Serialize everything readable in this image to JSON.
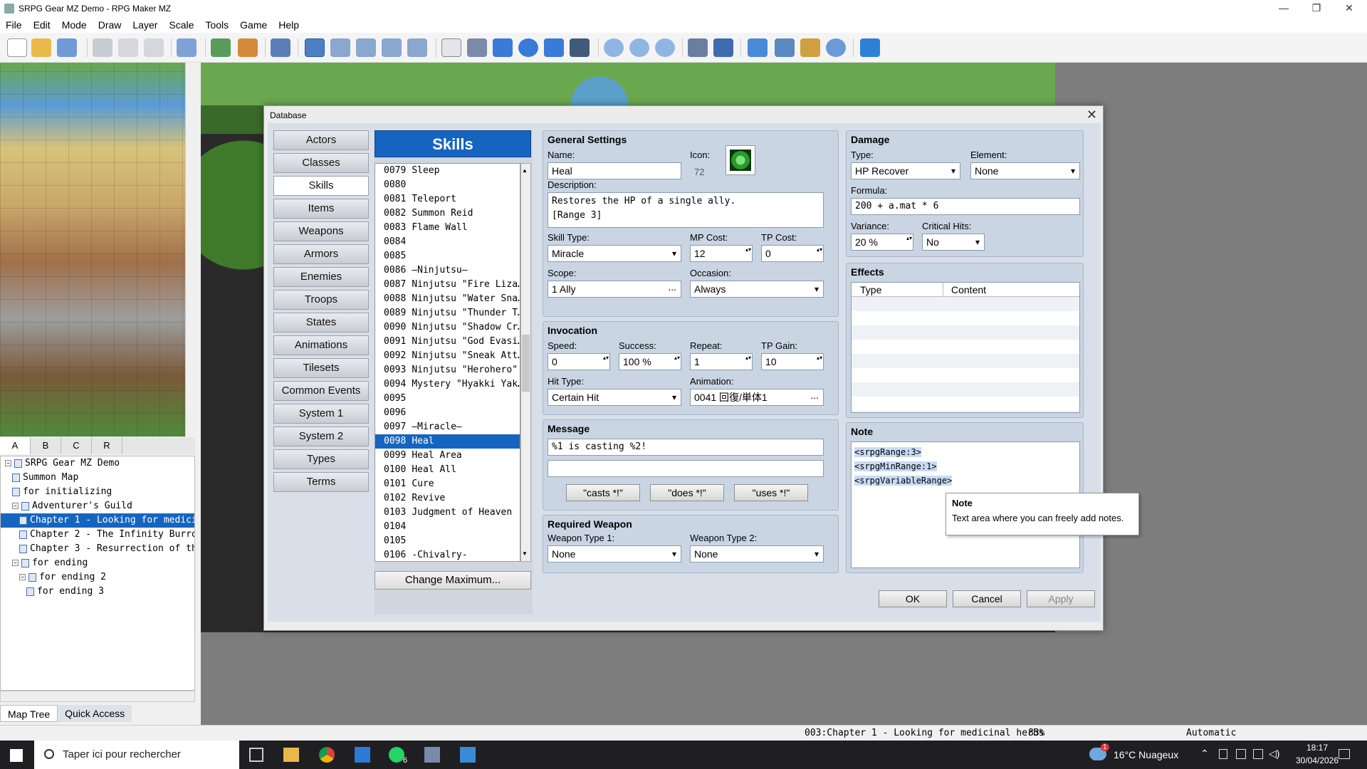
{
  "window": {
    "title": "SRPG Gear MZ Demo - RPG Maker MZ",
    "minimize": "—",
    "restore": "❐",
    "close": "✕"
  },
  "menu": [
    "File",
    "Edit",
    "Mode",
    "Draw",
    "Layer",
    "Scale",
    "Tools",
    "Game",
    "Help"
  ],
  "tile_tabs": [
    "A",
    "B",
    "C",
    "R"
  ],
  "map_tree": [
    {
      "label": "SRPG Gear MZ Demo",
      "level": 0,
      "expander": "−",
      "selected": false
    },
    {
      "label": "Summon Map",
      "level": 1,
      "expander": "",
      "selected": false
    },
    {
      "label": "for initializing",
      "level": 1,
      "expander": "",
      "selected": false
    },
    {
      "label": "Adventurer's Guild",
      "level": 1,
      "expander": "−",
      "selected": false
    },
    {
      "label": "Chapter 1 - Looking for medicinal herbs",
      "level": 2,
      "expander": "",
      "selected": true
    },
    {
      "label": "Chapter 2 - The Infinity Burrow",
      "level": 2,
      "expander": "",
      "selected": false
    },
    {
      "label": "Chapter 3 - Resurrection of the",
      "level": 2,
      "expander": "",
      "selected": false
    },
    {
      "label": "for ending",
      "level": 1,
      "expander": "−",
      "selected": false
    },
    {
      "label": "for ending 2",
      "level": 2,
      "expander": "−",
      "selected": false
    },
    {
      "label": "for ending 3",
      "level": 3,
      "expander": "",
      "selected": false
    }
  ],
  "bottom_tabs": {
    "map_tree": "Map Tree",
    "quick_access": "Quick Access"
  },
  "status": {
    "map": "003:Chapter 1 - Looking for medicinal herbs",
    "zoom": "83%",
    "mode": "Automatic"
  },
  "taskbar": {
    "search_placeholder": "Taper ici pour rechercher",
    "weather": "16°C Nuageux",
    "time": "18:17",
    "date": "30/04/2026",
    "whatsapp_badge": "6",
    "weather_badge": "1"
  },
  "dialog": {
    "title": "Database",
    "close": "✕",
    "categories": [
      "Actors",
      "Classes",
      "Skills",
      "Items",
      "Weapons",
      "Armors",
      "Enemies",
      "Troops",
      "States",
      "Animations",
      "Tilesets",
      "Common Events",
      "System 1",
      "System 2",
      "Types",
      "Terms"
    ],
    "active_category": "Skills",
    "list_title": "Skills",
    "skills": [
      {
        "id": "0079",
        "name": "Sleep"
      },
      {
        "id": "0080",
        "name": ""
      },
      {
        "id": "0081",
        "name": "Teleport"
      },
      {
        "id": "0082",
        "name": "Summon Reid"
      },
      {
        "id": "0083",
        "name": "Flame Wall"
      },
      {
        "id": "0084",
        "name": ""
      },
      {
        "id": "0085",
        "name": ""
      },
      {
        "id": "0086",
        "name": "—Ninjutsu—"
      },
      {
        "id": "0087",
        "name": "Ninjutsu \"Fire Liza…"
      },
      {
        "id": "0088",
        "name": "Ninjutsu \"Water Sna…"
      },
      {
        "id": "0089",
        "name": "Ninjutsu \"Thunder T…"
      },
      {
        "id": "0090",
        "name": "Ninjutsu \"Shadow Cr…"
      },
      {
        "id": "0091",
        "name": "Ninjutsu \"God Evasi…"
      },
      {
        "id": "0092",
        "name": "Ninjutsu \"Sneak Att…"
      },
      {
        "id": "0093",
        "name": "Ninjutsu \"Herohero\""
      },
      {
        "id": "0094",
        "name": "Mystery \"Hyakki Yak…"
      },
      {
        "id": "0095",
        "name": ""
      },
      {
        "id": "0096",
        "name": ""
      },
      {
        "id": "0097",
        "name": "—Miracle—"
      },
      {
        "id": "0098",
        "name": "Heal"
      },
      {
        "id": "0099",
        "name": "Heal Area"
      },
      {
        "id": "0100",
        "name": "Heal All"
      },
      {
        "id": "0101",
        "name": "Cure"
      },
      {
        "id": "0102",
        "name": "Revive"
      },
      {
        "id": "0103",
        "name": "Judgment of Heaven"
      },
      {
        "id": "0104",
        "name": ""
      },
      {
        "id": "0105",
        "name": ""
      },
      {
        "id": "0106",
        "name": "-Chivalry-"
      }
    ],
    "selected_skill": "0098",
    "change_max": "Change Maximum...",
    "general": {
      "title": "General Settings",
      "name_label": "Name:",
      "name": "Heal",
      "icon_label": "Icon:",
      "icon_index": "72",
      "desc_label": "Description:",
      "desc_line1": "Restores the HP of a single ally.",
      "desc_line2": "[Range 3]",
      "skill_type_label": "Skill Type:",
      "skill_type": "Miracle",
      "mp_label": "MP Cost:",
      "mp": "12",
      "tp_label": "TP Cost:",
      "tp": "0",
      "scope_label": "Scope:",
      "scope": "1 Ally",
      "occasion_label": "Occasion:",
      "occasion": "Always"
    },
    "invocation": {
      "title": "Invocation",
      "speed_label": "Speed:",
      "speed": "0",
      "success_label": "Success:",
      "success": "100 %",
      "repeat_label": "Repeat:",
      "repeat": "1",
      "tpgain_label": "TP Gain:",
      "tpgain": "10",
      "hit_label": "Hit Type:",
      "hit": "Certain Hit",
      "anim_label": "Animation:",
      "anim": "0041 回復/単体1"
    },
    "message": {
      "title": "Message",
      "line1": "%1 is casting %2!",
      "line2": "",
      "btn1": "\"casts *!\"",
      "btn2": "\"does *!\"",
      "btn3": "\"uses *!\""
    },
    "weapon": {
      "title": "Required Weapon",
      "w1_label": "Weapon Type 1:",
      "w1": "None",
      "w2_label": "Weapon Type 2:",
      "w2": "None"
    },
    "damage": {
      "title": "Damage",
      "type_label": "Type:",
      "type": "HP Recover",
      "element_label": "Element:",
      "element": "None",
      "formula_label": "Formula:",
      "formula": "200 + a.mat * 6",
      "variance_label": "Variance:",
      "variance": "20 %",
      "crit_label": "Critical Hits:",
      "crit": "No"
    },
    "effects": {
      "title": "Effects",
      "col_type": "Type",
      "col_content": "Content"
    },
    "note": {
      "title": "Note",
      "line1": "<srpgRange:3>",
      "line2": "<srpgMinRange:1>",
      "line3": "<srpgVariableRange>"
    },
    "tooltip": {
      "title": "Note",
      "text": "Text area where you can freely add notes."
    },
    "buttons": {
      "ok": "OK",
      "cancel": "Cancel",
      "apply": "Apply"
    }
  },
  "colors": {
    "accent": "#1565c0",
    "panel": "#c9d5e3",
    "map_bg": "#7d7d7d"
  }
}
